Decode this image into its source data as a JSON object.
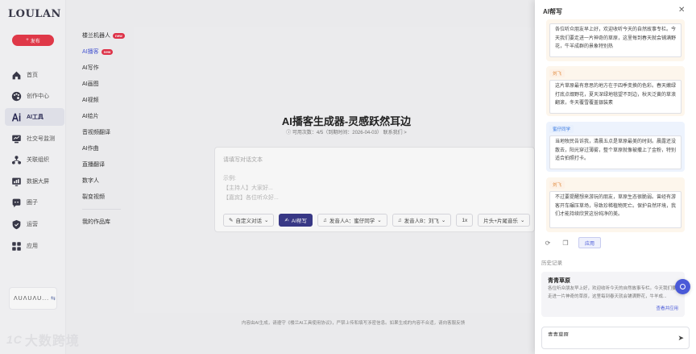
{
  "app": {
    "logo": "LOULAN",
    "publish_label": "发布"
  },
  "nav": {
    "items": [
      {
        "key": "home",
        "label": "首页",
        "icon": "home-icon"
      },
      {
        "key": "creator",
        "label": "创作中心",
        "icon": "palette-icon"
      },
      {
        "key": "ai",
        "label": "AI工具",
        "icon": "ai-icon",
        "active": true
      },
      {
        "key": "social",
        "label": "社交号监测",
        "icon": "monitor-icon"
      },
      {
        "key": "org",
        "label": "关联组织",
        "icon": "org-icon"
      },
      {
        "key": "dashboard",
        "label": "数据大屏",
        "icon": "dashboard-icon"
      },
      {
        "key": "circle",
        "label": "圈子",
        "icon": "circle-icon"
      },
      {
        "key": "ops",
        "label": "运营",
        "icon": "shield-icon"
      },
      {
        "key": "apps",
        "label": "应用",
        "icon": "apps-icon"
      }
    ],
    "user_name": "ΛUΛUΛU..."
  },
  "submenu": {
    "items": [
      {
        "label": "楼兰机器人",
        "new": true
      },
      {
        "label": "AI播客",
        "new": true,
        "active": true
      },
      {
        "label": "AI写作"
      },
      {
        "label": "AI画图"
      },
      {
        "label": "AI视频"
      },
      {
        "label": "AI绘片"
      },
      {
        "label": "音视频翻译"
      },
      {
        "label": "AI作曲"
      },
      {
        "label": "直播翻译"
      },
      {
        "label": "数字人"
      },
      {
        "label": "裂变视频"
      }
    ],
    "new_badge": "new",
    "works_label": "我的作品库"
  },
  "main": {
    "title": "AI播客生成器-灵感跃然耳边",
    "usage": "可用次数：4/5（到期时间：2026-04-03） 联系我们 >",
    "editor_placeholder": "请填写对话文本",
    "example_lines": [
      "示例:",
      "【主持人】大家好...",
      "【嘉宾】各位听众好..."
    ],
    "toolbar": {
      "custom_dialog": "自定义对话",
      "ai_help": "AI帮写",
      "voice_a": "发音人A：蜜仔同学",
      "voice_b": "发音人B：刘飞",
      "speed": "1x",
      "music": "片头+片尾音乐"
    },
    "footer_note": "内容由AI生成，请遵守《楼兰AI工具使用协议》，严禁上传和填写涉密信息。如果生成的内容不合适，请向客服反馈",
    "watermark": "大数跨境",
    "watermark_mark": "1C"
  },
  "drawer": {
    "title": "AI帮写",
    "messages": [
      {
        "role": "host",
        "speaker": "",
        "text": "各位听众朋友早上好，欢迎收听今天的自然故事专栏。今天我们要走进一片神奇的草原，这里每到春天就会铺满野花，牛羊成群的景象特别热"
      },
      {
        "role": "host",
        "speaker": "刘飞",
        "text": "这片草原最有意思的地方在于四季变换的色彩。春天嫩绿打底点缀野花，夏天深绿地毯望不到边，秋天泛黄的草浪翻滚，冬天覆雪覆盖银装素"
      },
      {
        "role": "guest",
        "speaker": "蜜仔同学",
        "text": "当地牧民告诉我，清晨五点是草原最美的时刻。晨露还没散去，阳光穿过薄雾，整个草原就像被撒上了金粉，特别适合拍照打卡。"
      },
      {
        "role": "host",
        "speaker": "刘飞",
        "text": "不过要提醒想来游玩的朋友，草原生态很脆弱。曾经有游客开车碾压草场，导致珍稀植物死亡。保护自然环境，我们才能持续欣赏这份纯净的美。"
      }
    ],
    "apply_label": "应用",
    "history_label": "历史记录",
    "history": {
      "title": "青青草原",
      "desc": "各位听众朋友早上好，欢迎收听今天的自然故事专栏。今天我们要走进一片神奇的草原，这里每到春天就会铺满野花，牛羊成...",
      "link": "查看并应用"
    },
    "input_value": "青青草原"
  }
}
